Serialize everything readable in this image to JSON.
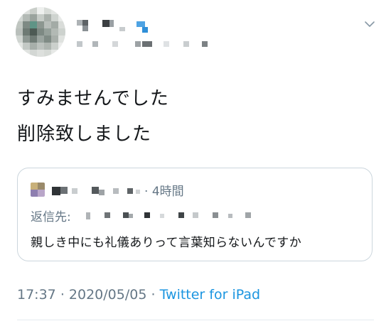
{
  "tweet": {
    "author_name": "",
    "author_handle": "",
    "text_lines": [
      "すみませんでした",
      "削除致しました"
    ],
    "more_icon": "chevron-down-icon"
  },
  "quoted_tweet": {
    "time_ago": "4時間",
    "reply_label": "返信先:",
    "text": "親しき中にも礼儀ありって言葉知らないんですか"
  },
  "footer": {
    "time": "17:37",
    "separator": "·",
    "date": "2020/05/05",
    "source": "Twitter for iPad"
  },
  "colors": {
    "text": "#14171a",
    "secondary": "#657786",
    "link": "#1b95e0",
    "border": "#ccd6dd"
  }
}
